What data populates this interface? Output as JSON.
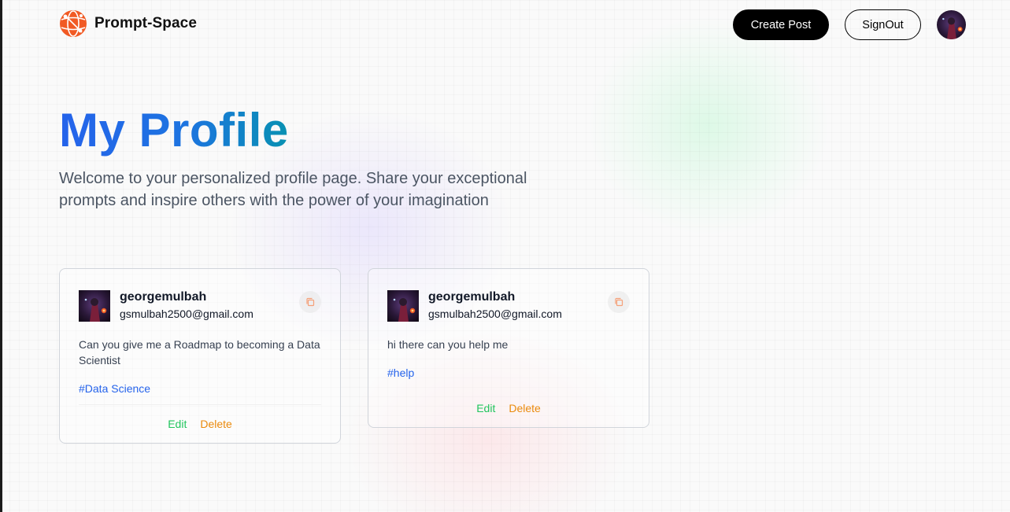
{
  "app": {
    "name": "Prompt-Space"
  },
  "nav": {
    "create_post_label": "Create Post",
    "signout_label": "SignOut"
  },
  "hero": {
    "title": "My Profile",
    "description": "Welcome to your personalized profile page. Share your exceptional prompts and inspire others with the power of your imagination"
  },
  "colors": {
    "brand_orange": "#f15a24",
    "title_blue": "#2563eb",
    "title_teal": "#0891b2",
    "tag_blue": "#2563eb",
    "edit_green": "#22c55e",
    "delete_orange": "#ea8a0c"
  },
  "icons": {
    "logo": "globe-network-icon",
    "copy": "copy-icon"
  },
  "posts": [
    {
      "username": "georgemulbah",
      "email": "gsmulbah2500@gmail.com",
      "prompt": "Can you give me a Roadmap to becoming a Data Scientist",
      "tag": "#Data Science",
      "edit_label": "Edit",
      "delete_label": "Delete"
    },
    {
      "username": "georgemulbah",
      "email": "gsmulbah2500@gmail.com",
      "prompt": "hi there can you help me",
      "tag": "#help",
      "edit_label": "Edit",
      "delete_label": "Delete"
    }
  ]
}
